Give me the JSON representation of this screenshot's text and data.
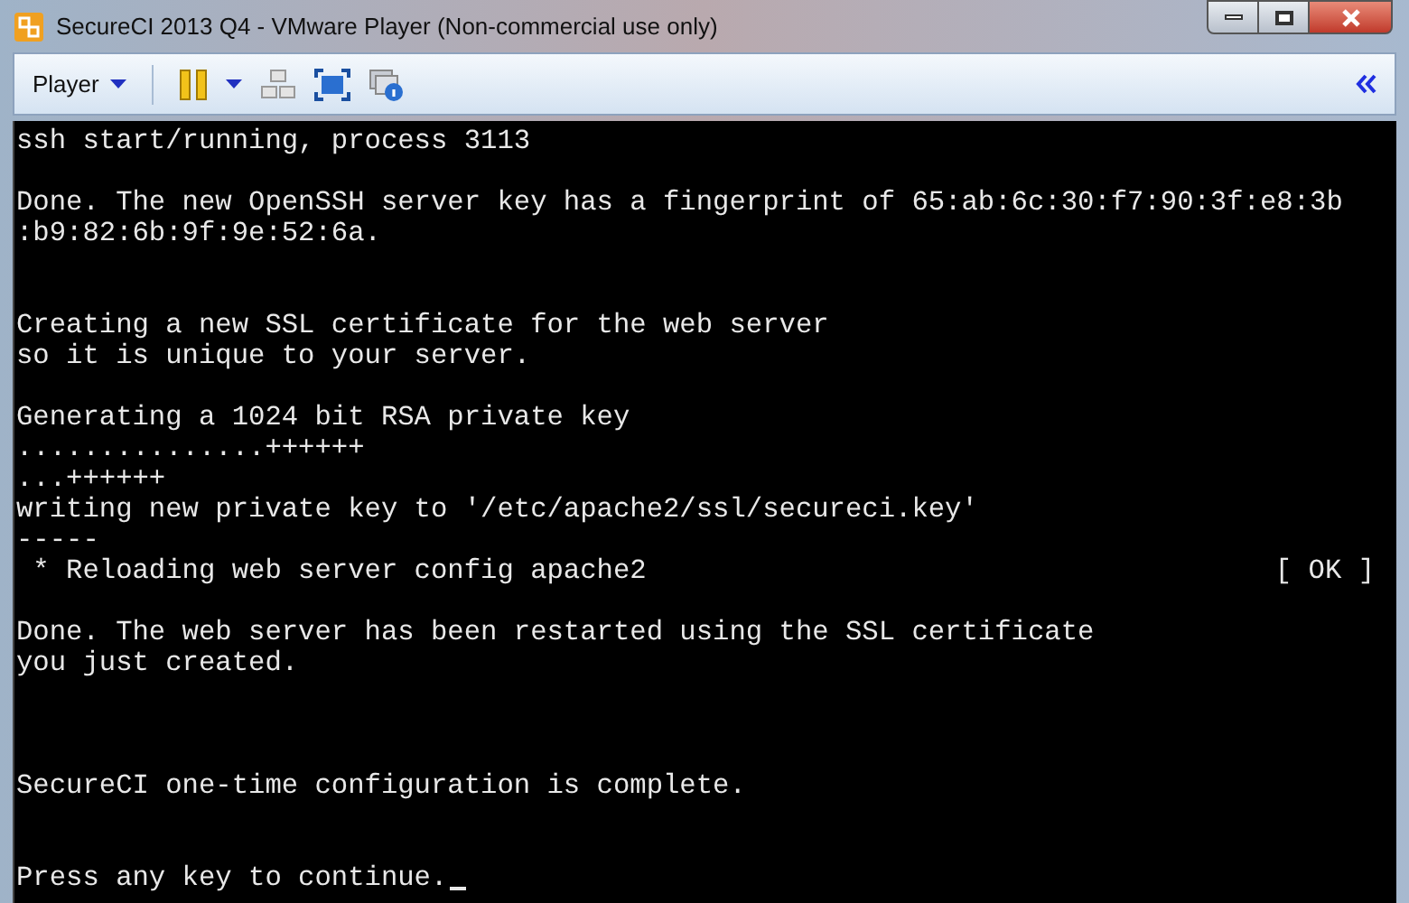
{
  "window": {
    "title": "SecureCI 2013 Q4 - VMware Player (Non-commercial use only)"
  },
  "toolbar": {
    "player_menu": "Player"
  },
  "terminal": {
    "lines": [
      {
        "kind": "text",
        "text": "ssh start/running, process 3113"
      },
      {
        "kind": "blank"
      },
      {
        "kind": "text",
        "text": "Done. The new OpenSSH server key has a fingerprint of 65:ab:6c:30:f7:90:3f:e8:3b"
      },
      {
        "kind": "text",
        "text": ":b9:82:6b:9f:9e:52:6a."
      },
      {
        "kind": "blank"
      },
      {
        "kind": "blank"
      },
      {
        "kind": "text",
        "text": "Creating a new SSL certificate for the web server"
      },
      {
        "kind": "text",
        "text": "so it is unique to your server."
      },
      {
        "kind": "blank"
      },
      {
        "kind": "text",
        "text": "Generating a 1024 bit RSA private key"
      },
      {
        "kind": "text",
        "text": "...............++++++"
      },
      {
        "kind": "text",
        "text": "...++++++"
      },
      {
        "kind": "text",
        "text": "writing new private key to '/etc/apache2/ssl/secureci.key'"
      },
      {
        "kind": "text",
        "text": "-----"
      },
      {
        "kind": "status",
        "text": " * Reloading web server config apache2",
        "status": "[ OK ]"
      },
      {
        "kind": "blank"
      },
      {
        "kind": "text",
        "text": "Done. The web server has been restarted using the SSL certificate"
      },
      {
        "kind": "text",
        "text": "you just created."
      },
      {
        "kind": "blank"
      },
      {
        "kind": "blank"
      },
      {
        "kind": "blank"
      },
      {
        "kind": "text",
        "text": "SecureCI one-time configuration is complete."
      },
      {
        "kind": "blank"
      },
      {
        "kind": "blank"
      },
      {
        "kind": "prompt",
        "text": "Press any key to continue."
      }
    ]
  }
}
